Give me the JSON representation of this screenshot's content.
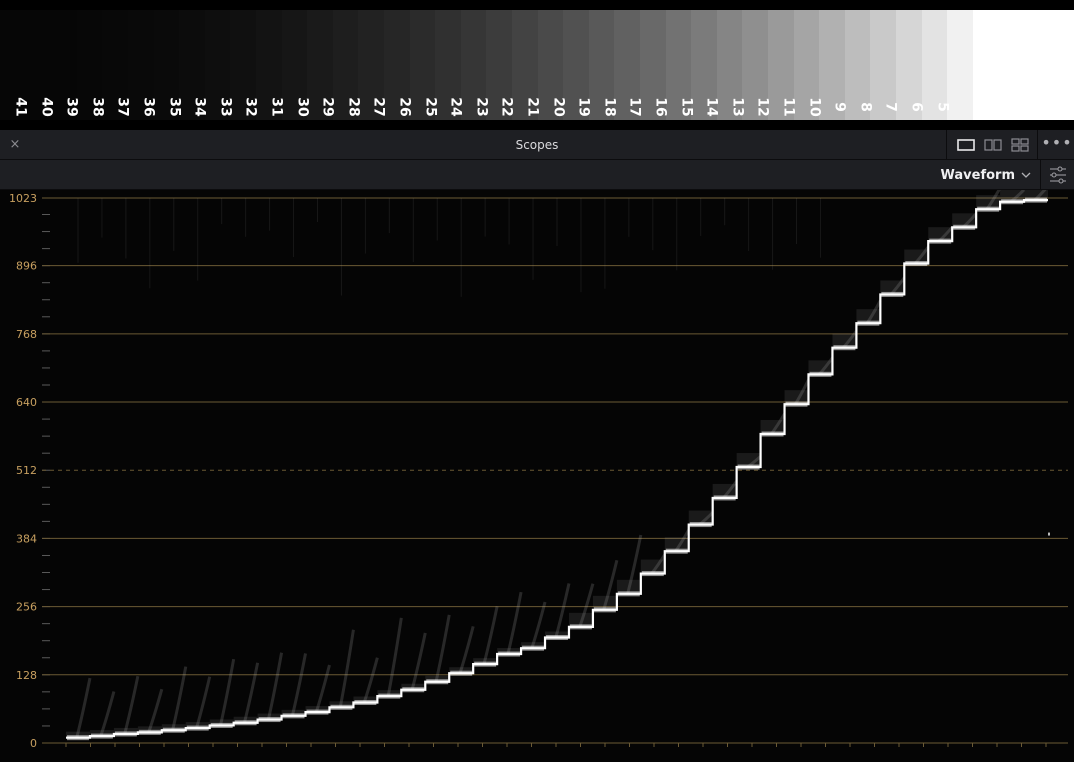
{
  "chart_data": {
    "type": "waveform",
    "title": "Scopes",
    "y_ticks": [
      0,
      128,
      256,
      384,
      512,
      640,
      768,
      896,
      1023
    ],
    "ylim": [
      0,
      1023
    ],
    "grid": true,
    "step_levels": [
      10,
      13,
      17,
      20,
      24,
      28,
      33,
      38,
      44,
      51,
      58,
      67,
      76,
      88,
      100,
      115,
      131,
      148,
      167,
      178,
      198,
      218,
      250,
      280,
      318,
      360,
      410,
      460,
      518,
      580,
      636,
      692,
      742,
      788,
      842,
      900,
      942,
      968,
      1002,
      1016,
      1019
    ],
    "colors": {
      "trace": "#ffffff",
      "grid": "#6b5a35",
      "tick_label": "#c8a060"
    }
  },
  "gradient": {
    "patch_numbers": [
      "41",
      "40",
      "39",
      "38",
      "37",
      "36",
      "35",
      "34",
      "33",
      "32",
      "31",
      "30",
      "29",
      "28",
      "27",
      "26",
      "25",
      "24",
      "23",
      "22",
      "21",
      "20",
      "19",
      "18",
      "17",
      "16",
      "15",
      "14",
      "13",
      "12",
      "11",
      "10",
      "9",
      "8",
      "7",
      "6",
      "5"
    ]
  },
  "panel": {
    "title": "Scopes",
    "close_icon": "×",
    "more_icon": "•••",
    "scope_type": "Waveform",
    "icons": [
      "close-icon",
      "single-view-icon",
      "dual-view-icon",
      "quad-view-icon",
      "more-icon",
      "chevron-down-icon",
      "settings-sliders-icon"
    ]
  }
}
